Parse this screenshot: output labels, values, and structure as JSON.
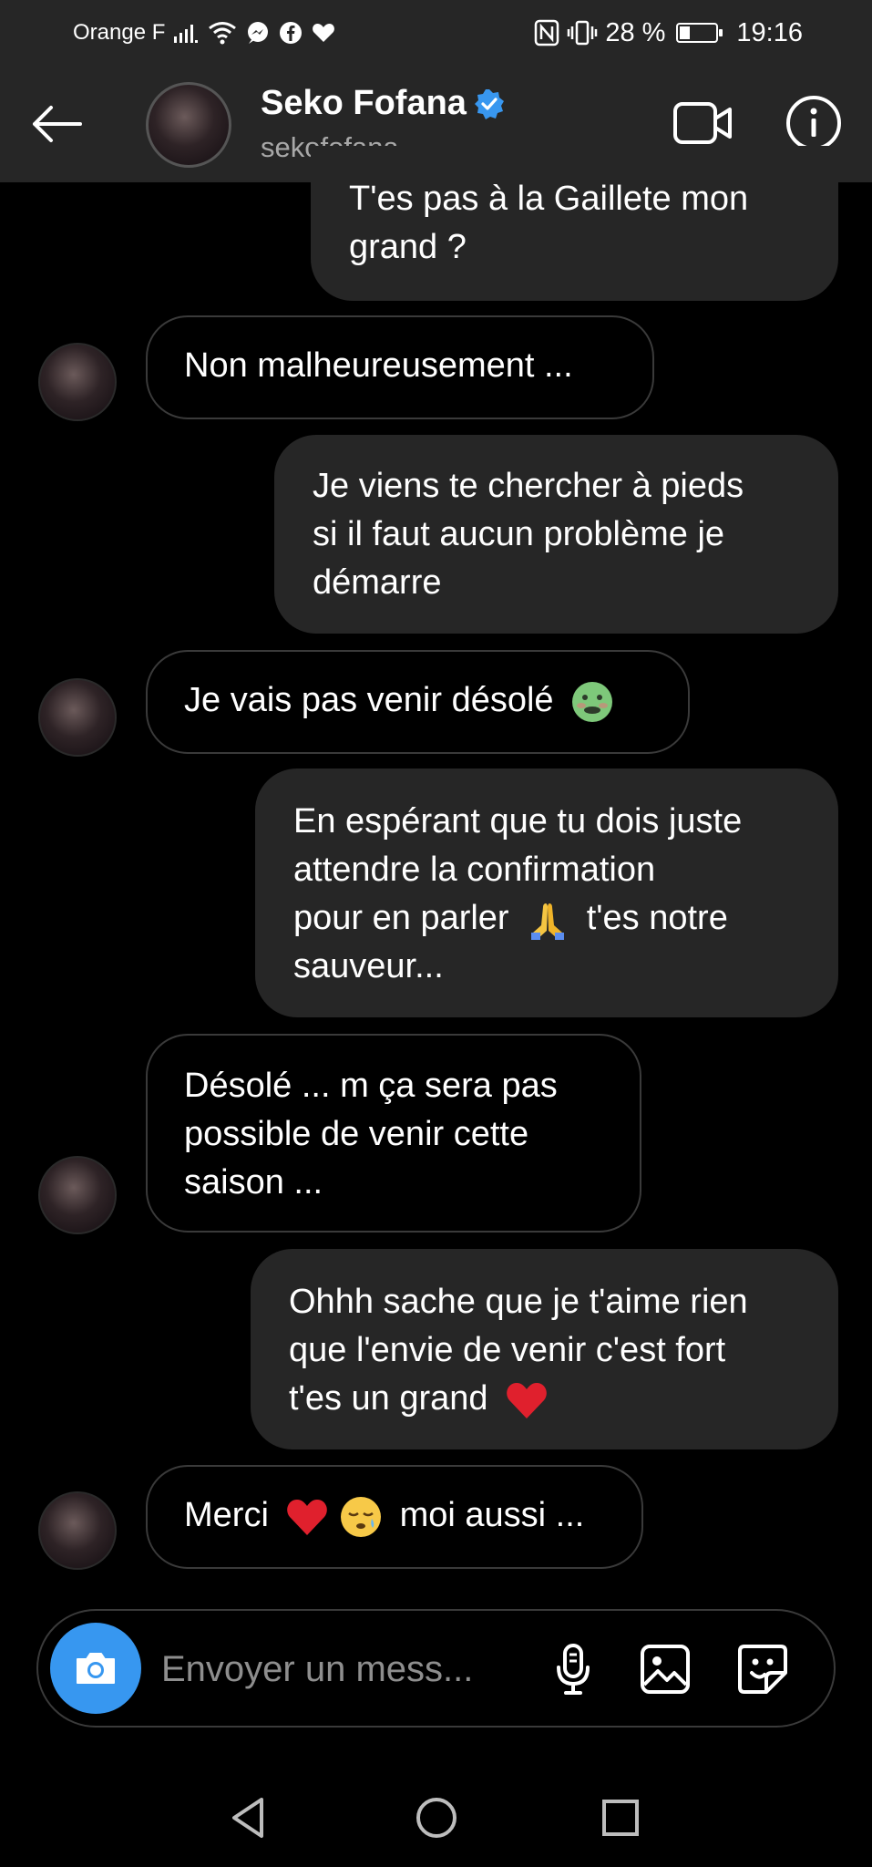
{
  "status_bar": {
    "carrier": "Orange F",
    "battery_percent": "28 %",
    "battery_level": 0.28,
    "time": "19:16"
  },
  "header": {
    "name": "Seko Fofana",
    "username": "sekofofana",
    "back_icon": "back-arrow-icon",
    "video_icon": "video-call-icon",
    "info_icon": "info-icon",
    "verified_color": "#3897f0"
  },
  "messages": [
    {
      "direction": "out",
      "lines": [
        "T'es pas à la Gaillete mon",
        "grand ?"
      ]
    },
    {
      "direction": "in",
      "lines": [
        "Non malheureusement ..."
      ]
    },
    {
      "direction": "out",
      "lines": [
        "Je viens te chercher à pieds",
        "si il faut aucun problème je",
        "démarre"
      ]
    },
    {
      "direction": "in",
      "lines": [
        "Je vais pas venir désolé"
      ],
      "emoji": "nauseated-face"
    },
    {
      "direction": "out",
      "lines": [
        "En espérant que tu dois juste",
        "attendre la confirmation",
        "pour en parler",
        "t'es notre",
        "sauveur..."
      ],
      "emoji": "folded-hands"
    },
    {
      "direction": "in",
      "lines": [
        "Désolé ... m ça sera pas",
        "possible de venir cette",
        "saison ..."
      ]
    },
    {
      "direction": "out",
      "lines": [
        "Ohhh sache que je t'aime rien",
        "que l'envie de venir c'est fort",
        "t'es un grand"
      ],
      "emoji": "red-heart"
    },
    {
      "direction": "in",
      "lines": [
        "Merci",
        "moi aussi ..."
      ],
      "emoji": "red-heart, sleepy-face"
    }
  ],
  "composer": {
    "placeholder": "Envoyer un mess...",
    "camera_icon": "camera-icon",
    "mic_icon": "microphone-icon",
    "gallery_icon": "gallery-icon",
    "sticker_icon": "sticker-icon",
    "accent_color": "#3797f0"
  },
  "navbar": {
    "back_icon": "nav-back-icon",
    "home_icon": "nav-home-icon",
    "recents_icon": "nav-recents-icon"
  }
}
